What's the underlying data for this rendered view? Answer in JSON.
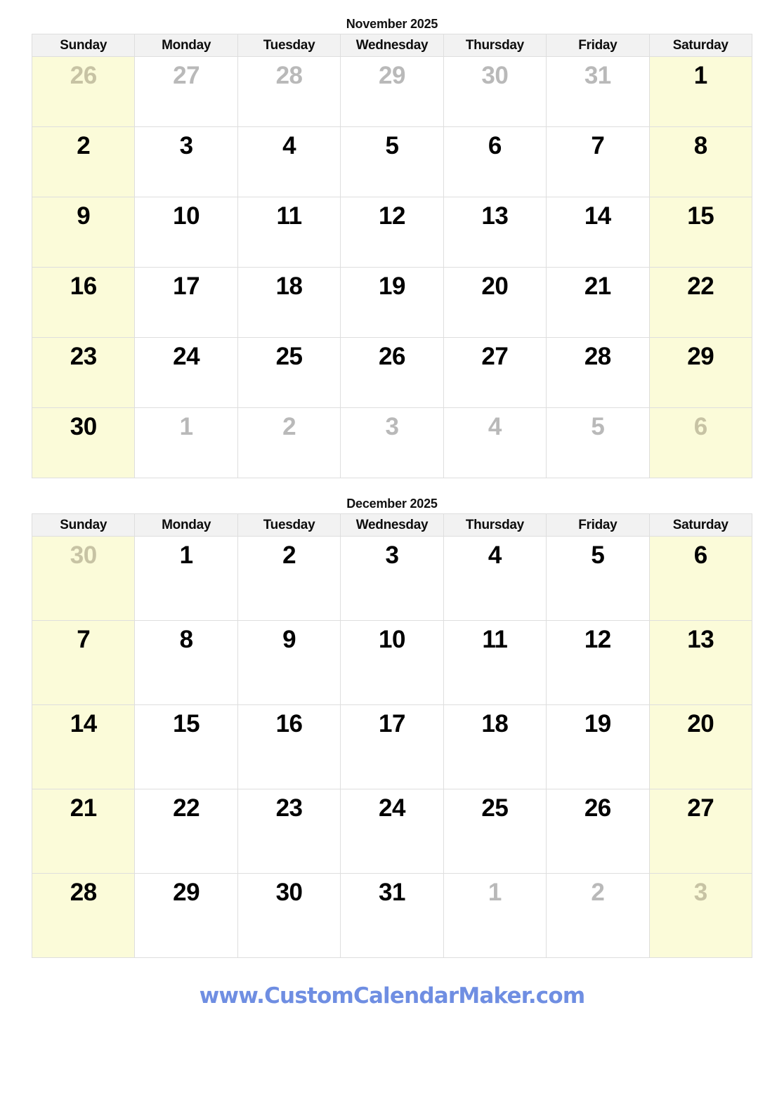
{
  "page": {
    "background_color": "#ffffff",
    "weekend_color": "#fbfbd9",
    "header_color": "#f2f2f2",
    "grid_line_color": "#dedede",
    "out_of_month_color": "#b9b9b9",
    "footer_color": "#6f8ee2"
  },
  "weekdays": [
    "Sunday",
    "Monday",
    "Tuesday",
    "Wednesday",
    "Thursday",
    "Friday",
    "Saturday"
  ],
  "months": [
    {
      "title": "November 2025",
      "weeks": [
        [
          {
            "n": "26",
            "out": true
          },
          {
            "n": "27",
            "out": true
          },
          {
            "n": "28",
            "out": true
          },
          {
            "n": "29",
            "out": true
          },
          {
            "n": "30",
            "out": true
          },
          {
            "n": "31",
            "out": true
          },
          {
            "n": "1",
            "out": false
          }
        ],
        [
          {
            "n": "2",
            "out": false
          },
          {
            "n": "3",
            "out": false
          },
          {
            "n": "4",
            "out": false
          },
          {
            "n": "5",
            "out": false
          },
          {
            "n": "6",
            "out": false
          },
          {
            "n": "7",
            "out": false
          },
          {
            "n": "8",
            "out": false
          }
        ],
        [
          {
            "n": "9",
            "out": false
          },
          {
            "n": "10",
            "out": false
          },
          {
            "n": "11",
            "out": false
          },
          {
            "n": "12",
            "out": false
          },
          {
            "n": "13",
            "out": false
          },
          {
            "n": "14",
            "out": false
          },
          {
            "n": "15",
            "out": false
          }
        ],
        [
          {
            "n": "16",
            "out": false
          },
          {
            "n": "17",
            "out": false
          },
          {
            "n": "18",
            "out": false
          },
          {
            "n": "19",
            "out": false
          },
          {
            "n": "20",
            "out": false
          },
          {
            "n": "21",
            "out": false
          },
          {
            "n": "22",
            "out": false
          }
        ],
        [
          {
            "n": "23",
            "out": false
          },
          {
            "n": "24",
            "out": false
          },
          {
            "n": "25",
            "out": false
          },
          {
            "n": "26",
            "out": false
          },
          {
            "n": "27",
            "out": false
          },
          {
            "n": "28",
            "out": false
          },
          {
            "n": "29",
            "out": false
          }
        ],
        [
          {
            "n": "30",
            "out": false
          },
          {
            "n": "1",
            "out": true
          },
          {
            "n": "2",
            "out": true
          },
          {
            "n": "3",
            "out": true
          },
          {
            "n": "4",
            "out": true
          },
          {
            "n": "5",
            "out": true
          },
          {
            "n": "6",
            "out": true
          }
        ]
      ]
    },
    {
      "title": "December 2025",
      "weeks": [
        [
          {
            "n": "30",
            "out": true
          },
          {
            "n": "1",
            "out": false
          },
          {
            "n": "2",
            "out": false
          },
          {
            "n": "3",
            "out": false
          },
          {
            "n": "4",
            "out": false
          },
          {
            "n": "5",
            "out": false
          },
          {
            "n": "6",
            "out": false
          }
        ],
        [
          {
            "n": "7",
            "out": false
          },
          {
            "n": "8",
            "out": false
          },
          {
            "n": "9",
            "out": false
          },
          {
            "n": "10",
            "out": false
          },
          {
            "n": "11",
            "out": false
          },
          {
            "n": "12",
            "out": false
          },
          {
            "n": "13",
            "out": false
          }
        ],
        [
          {
            "n": "14",
            "out": false
          },
          {
            "n": "15",
            "out": false
          },
          {
            "n": "16",
            "out": false
          },
          {
            "n": "17",
            "out": false
          },
          {
            "n": "18",
            "out": false
          },
          {
            "n": "19",
            "out": false
          },
          {
            "n": "20",
            "out": false
          }
        ],
        [
          {
            "n": "21",
            "out": false
          },
          {
            "n": "22",
            "out": false
          },
          {
            "n": "23",
            "out": false
          },
          {
            "n": "24",
            "out": false
          },
          {
            "n": "25",
            "out": false
          },
          {
            "n": "26",
            "out": false
          },
          {
            "n": "27",
            "out": false
          }
        ],
        [
          {
            "n": "28",
            "out": false
          },
          {
            "n": "29",
            "out": false
          },
          {
            "n": "30",
            "out": false
          },
          {
            "n": "31",
            "out": false
          },
          {
            "n": "1",
            "out": true
          },
          {
            "n": "2",
            "out": true
          },
          {
            "n": "3",
            "out": true
          }
        ]
      ]
    }
  ],
  "footer": {
    "text": "www.CustomCalendarMaker.com"
  }
}
